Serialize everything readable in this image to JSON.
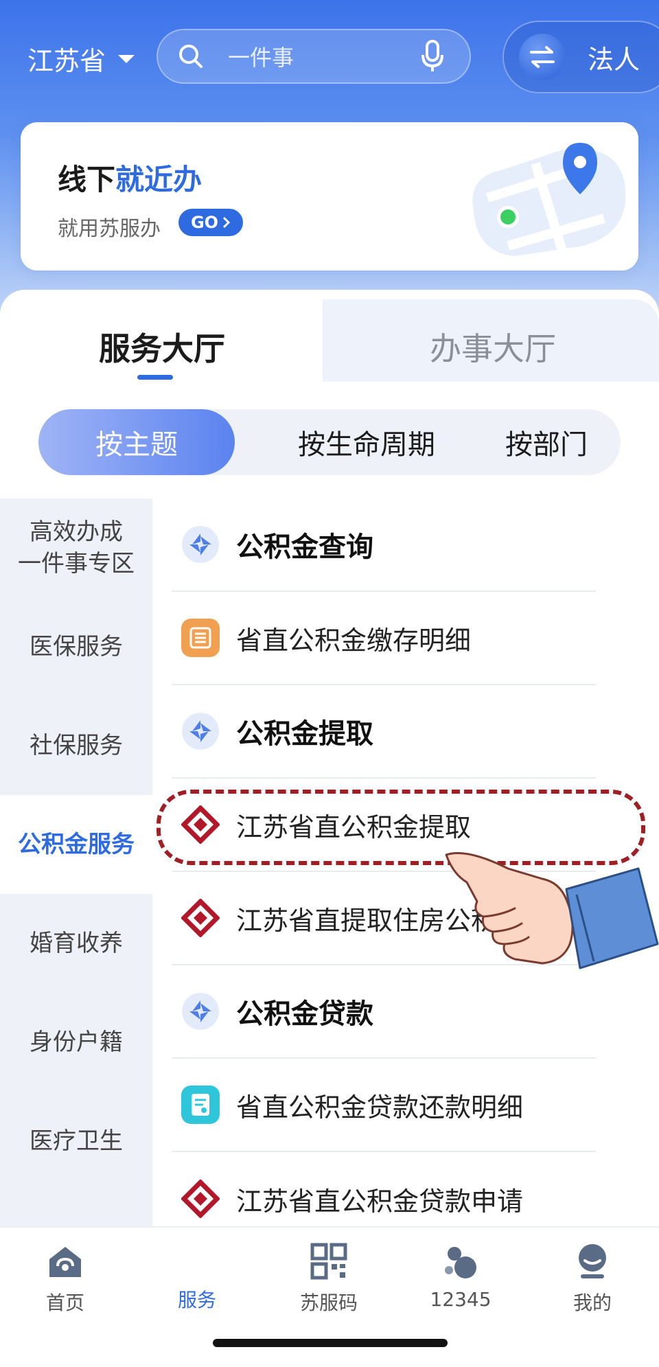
{
  "header": {
    "province": "江苏省",
    "search_placeholder": "一件事",
    "identity_label": "法人"
  },
  "banner": {
    "title_prefix": "线下",
    "title_highlight": "就近办",
    "subtitle": "就用苏服办",
    "go_label": "GO"
  },
  "main_tabs": [
    {
      "label": "服务大厅",
      "active": true
    },
    {
      "label": "办事大厅",
      "active": false
    }
  ],
  "segments": [
    {
      "label": "按主题",
      "active": true
    },
    {
      "label": "按生命周期",
      "active": false
    },
    {
      "label": "按部门",
      "active": false
    }
  ],
  "sidebar": {
    "items": [
      {
        "label": "高效办成一件事专区",
        "line1": "高效办成",
        "line2": "一件事专区"
      },
      {
        "label": "医保服务"
      },
      {
        "label": "社保服务"
      },
      {
        "label": "公积金服务",
        "active": true
      },
      {
        "label": "婚育收养"
      },
      {
        "label": "身份户籍"
      },
      {
        "label": "医疗卫生"
      }
    ]
  },
  "service_list": [
    {
      "label": "公积金查询",
      "kind": "header",
      "icon": "category-icon"
    },
    {
      "label": "省直公积金缴存明细",
      "kind": "item",
      "icon": "list-doc-icon"
    },
    {
      "label": "公积金提取",
      "kind": "header",
      "icon": "category-icon"
    },
    {
      "label": "江苏省直公积金提取",
      "kind": "item",
      "icon": "housing-fund-logo-icon",
      "highlighted": true
    },
    {
      "label": "江苏省直提取住房公积",
      "kind": "item",
      "icon": "housing-fund-logo-icon"
    },
    {
      "label": "公积金贷款",
      "kind": "header",
      "icon": "category-icon"
    },
    {
      "label": "省直公积金贷款还款明细",
      "kind": "item",
      "icon": "receipt-icon"
    },
    {
      "label": "江苏省直公积金贷款申请",
      "kind": "item",
      "icon": "housing-fund-logo-icon"
    }
  ],
  "bottom_nav": [
    {
      "label": "首页",
      "icon": "home-icon"
    },
    {
      "label": "服务",
      "icon": "service-icon",
      "active": true
    },
    {
      "label": "苏服码",
      "icon": "qr-code-icon"
    },
    {
      "label": "12345",
      "icon": "hotline-icon"
    },
    {
      "label": "我的",
      "icon": "profile-icon"
    }
  ],
  "colors": {
    "accent": "#2f6be0",
    "highlight_border": "#9e1f24",
    "fund_logo": "#b3172a"
  }
}
